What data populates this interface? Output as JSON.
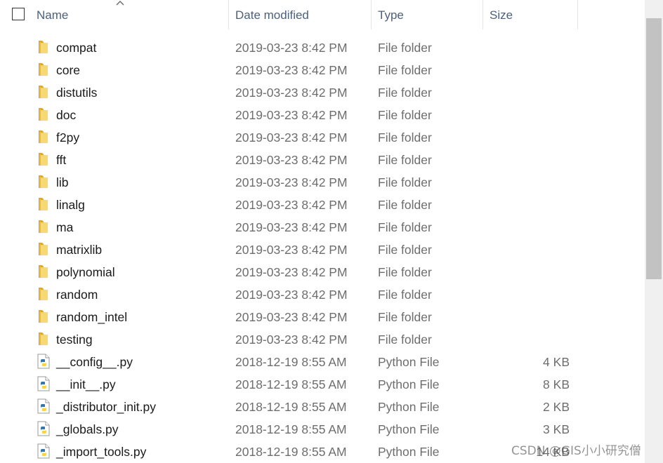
{
  "header": {
    "name_label": "Name",
    "date_label": "Date modified",
    "type_label": "Type",
    "size_label": "Size",
    "sort_icon": "chevron-up-icon"
  },
  "files": [
    {
      "name": "compat",
      "date": "2019-03-23 8:42 PM",
      "type": "File folder",
      "size": "",
      "icon": "folder-icon"
    },
    {
      "name": "core",
      "date": "2019-03-23 8:42 PM",
      "type": "File folder",
      "size": "",
      "icon": "folder-icon"
    },
    {
      "name": "distutils",
      "date": "2019-03-23 8:42 PM",
      "type": "File folder",
      "size": "",
      "icon": "folder-icon"
    },
    {
      "name": "doc",
      "date": "2019-03-23 8:42 PM",
      "type": "File folder",
      "size": "",
      "icon": "folder-icon"
    },
    {
      "name": "f2py",
      "date": "2019-03-23 8:42 PM",
      "type": "File folder",
      "size": "",
      "icon": "folder-icon"
    },
    {
      "name": "fft",
      "date": "2019-03-23 8:42 PM",
      "type": "File folder",
      "size": "",
      "icon": "folder-icon"
    },
    {
      "name": "lib",
      "date": "2019-03-23 8:42 PM",
      "type": "File folder",
      "size": "",
      "icon": "folder-icon"
    },
    {
      "name": "linalg",
      "date": "2019-03-23 8:42 PM",
      "type": "File folder",
      "size": "",
      "icon": "folder-icon"
    },
    {
      "name": "ma",
      "date": "2019-03-23 8:42 PM",
      "type": "File folder",
      "size": "",
      "icon": "folder-icon"
    },
    {
      "name": "matrixlib",
      "date": "2019-03-23 8:42 PM",
      "type": "File folder",
      "size": "",
      "icon": "folder-icon"
    },
    {
      "name": "polynomial",
      "date": "2019-03-23 8:42 PM",
      "type": "File folder",
      "size": "",
      "icon": "folder-icon"
    },
    {
      "name": "random",
      "date": "2019-03-23 8:42 PM",
      "type": "File folder",
      "size": "",
      "icon": "folder-icon"
    },
    {
      "name": "random_intel",
      "date": "2019-03-23 8:42 PM",
      "type": "File folder",
      "size": "",
      "icon": "folder-icon"
    },
    {
      "name": "testing",
      "date": "2019-03-23 8:42 PM",
      "type": "File folder",
      "size": "",
      "icon": "folder-icon"
    },
    {
      "name": "__config__.py",
      "date": "2018-12-19 8:55 AM",
      "type": "Python File",
      "size": "4 KB",
      "icon": "python-file-icon"
    },
    {
      "name": "__init__.py",
      "date": "2018-12-19 8:55 AM",
      "type": "Python File",
      "size": "8 KB",
      "icon": "python-file-icon"
    },
    {
      "name": "_distributor_init.py",
      "date": "2018-12-19 8:55 AM",
      "type": "Python File",
      "size": "2 KB",
      "icon": "python-file-icon"
    },
    {
      "name": "_globals.py",
      "date": "2018-12-19 8:55 AM",
      "type": "Python File",
      "size": "3 KB",
      "icon": "python-file-icon"
    },
    {
      "name": "_import_tools.py",
      "date": "2018-12-19 8:55 AM",
      "type": "Python File",
      "size": "14 KB",
      "icon": "python-file-icon"
    }
  ],
  "watermark": "CSDN @GIS小小研究僧",
  "colors": {
    "folder_yellow": "#f8d775",
    "folder_dark": "#e0a526",
    "python_blue": "#3776ab",
    "python_yellow": "#ffd43b",
    "header_text": "#4c607a"
  }
}
